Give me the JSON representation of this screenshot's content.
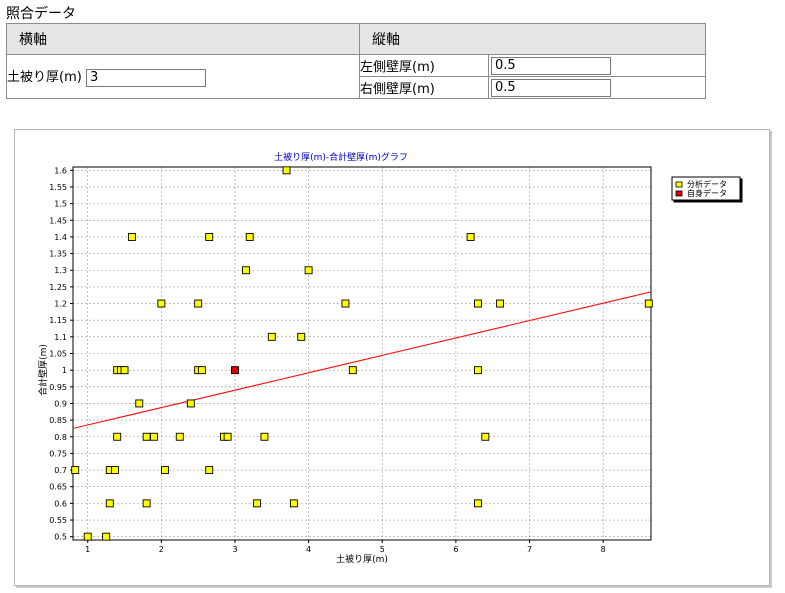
{
  "section_title": "照合データ",
  "table": {
    "x_header": "横軸",
    "y_header": "縦軸",
    "x_label": "土被り厚(m)",
    "x_value": "3",
    "y_rows": [
      {
        "label": "左側壁厚(m)",
        "value": "0.5"
      },
      {
        "label": "右側壁厚(m)",
        "value": "0.5"
      }
    ]
  },
  "colors": {
    "analysis_fill": "#ffff00",
    "own_fill": "#dd0000",
    "trend": "#ff0000",
    "title": "#0000cc"
  },
  "chart_data": {
    "type": "scatter",
    "title": "土被り厚(m)-合計壁厚(m)グラフ",
    "xlabel": "土被り厚(m)",
    "ylabel": "合計壁厚(m)",
    "xlim": [
      0.8,
      8.65
    ],
    "ylim": [
      0.49,
      1.61
    ],
    "x_ticks": [
      "1",
      "2",
      "3",
      "4",
      "5",
      "6",
      "7",
      "8"
    ],
    "y_ticks": [
      "0.5",
      "0.55",
      "0.6",
      "0.65",
      "0.7",
      "0.75",
      "0.8",
      "0.85",
      "0.9",
      "0.95",
      "1",
      "1.05",
      "1.1",
      "1.15",
      "1.2",
      "1.25",
      "1.3",
      "1.35",
      "1.4",
      "1.45",
      "1.5",
      "1.55",
      "1.6"
    ],
    "grid": true,
    "legend_position": "right",
    "series": [
      {
        "name": "分析データ",
        "points": [
          [
            1.0,
            0.5
          ],
          [
            1.25,
            0.5
          ],
          [
            0.83,
            0.7
          ],
          [
            1.3,
            0.6
          ],
          [
            1.3,
            0.7
          ],
          [
            1.37,
            0.7
          ],
          [
            1.4,
            0.8
          ],
          [
            1.4,
            1.0
          ],
          [
            1.45,
            1.0
          ],
          [
            1.5,
            1.0
          ],
          [
            1.6,
            1.4
          ],
          [
            1.7,
            0.9
          ],
          [
            1.8,
            0.8
          ],
          [
            1.8,
            0.6
          ],
          [
            1.9,
            0.8
          ],
          [
            2.0,
            1.2
          ],
          [
            2.05,
            0.7
          ],
          [
            2.25,
            0.8
          ],
          [
            2.4,
            0.9
          ],
          [
            2.5,
            1.0
          ],
          [
            2.5,
            1.2
          ],
          [
            2.55,
            1.0
          ],
          [
            2.65,
            1.4
          ],
          [
            2.65,
            0.7
          ],
          [
            2.85,
            0.8
          ],
          [
            2.9,
            0.8
          ],
          [
            3.15,
            1.3
          ],
          [
            3.2,
            1.4
          ],
          [
            3.3,
            0.6
          ],
          [
            3.4,
            0.8
          ],
          [
            3.5,
            1.1
          ],
          [
            3.7,
            1.6
          ],
          [
            3.8,
            0.6
          ],
          [
            3.9,
            1.1
          ],
          [
            4.0,
            1.3
          ],
          [
            4.5,
            1.2
          ],
          [
            4.6,
            1.0
          ],
          [
            6.2,
            1.4
          ],
          [
            6.3,
            1.2
          ],
          [
            6.3,
            1.0
          ],
          [
            6.3,
            0.6
          ],
          [
            6.4,
            0.8
          ],
          [
            6.6,
            1.2
          ],
          [
            8.62,
            1.2
          ]
        ]
      },
      {
        "name": "自身データ",
        "points": [
          [
            3.0,
            1.0
          ]
        ]
      }
    ],
    "trendline": {
      "x1": 0.8,
      "y1": 0.825,
      "x2": 8.65,
      "y2": 1.235
    }
  }
}
